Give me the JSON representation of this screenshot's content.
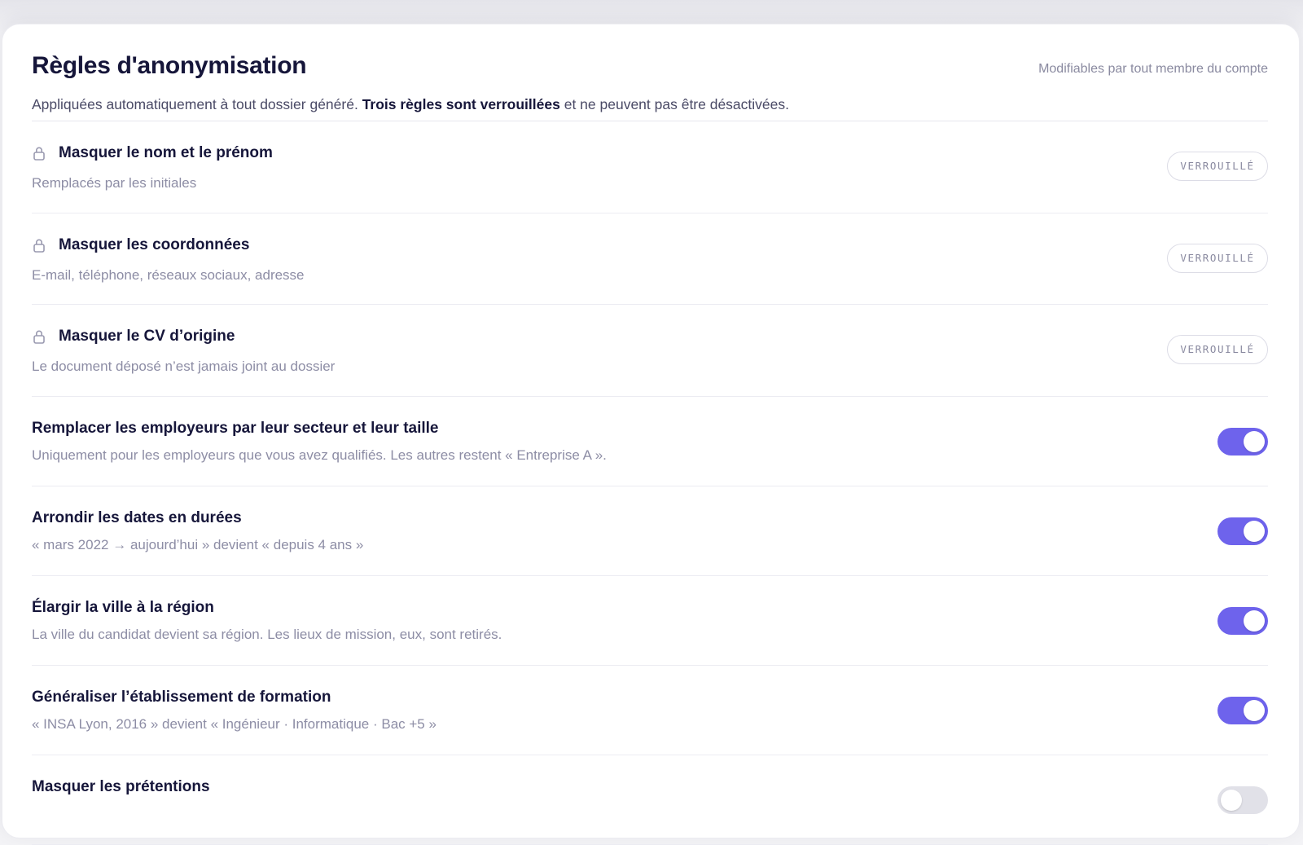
{
  "section": {
    "title": "Règles d'anonymisation",
    "note": "Modifiables par tout membre du compte",
    "subtitle_prefix": "Appliquées automatiquement à tout dossier généré. ",
    "subtitle_strong": "Trois règles sont verrouillées",
    "subtitle_suffix": " et ne peuvent pas être désactivées."
  },
  "locked_rules": [
    {
      "title": "Masquer le nom et le prénom",
      "description": "Remplacés par les initiales",
      "badge": "VERROUILLÉ",
      "icon": "lock-icon"
    },
    {
      "title": "Masquer les coordonnées",
      "description": "E-mail, téléphone, réseaux sociaux, adresse",
      "badge": "VERROUILLÉ",
      "icon": "lock-icon"
    },
    {
      "title": "Masquer le CV d’origine",
      "description": "Le document déposé n’est jamais joint au dossier",
      "badge": "VERROUILLÉ",
      "icon": "lock-icon"
    }
  ],
  "toggle_rules": [
    {
      "title": "Remplacer les employeurs par leur secteur et leur taille",
      "description": "Uniquement pour les employeurs que vous avez qualifiés. Les autres restent « Entreprise A ».",
      "enabled": true
    },
    {
      "title": "Arrondir les dates en durées",
      "description": "« mars 2022 → aujourd’hui » devient « depuis 4 ans »",
      "enabled": true
    },
    {
      "title": "Élargir la ville à la région",
      "description": "La ville du candidat devient sa région. Les lieux de mission, eux, sont retirés.",
      "enabled": true
    },
    {
      "title": "Généraliser l’établissement de formation",
      "description": "« INSA Lyon, 2016 » devient « Ingénieur · Informatique · Bac +5 »",
      "enabled": true
    },
    {
      "title": "Masquer les prétentions",
      "description": "",
      "enabled": false
    }
  ],
  "colors": {
    "accent": "#6e63ec",
    "toggle_off": "#e1e1e8",
    "title": "#16163a",
    "muted": "#8d8da5"
  }
}
